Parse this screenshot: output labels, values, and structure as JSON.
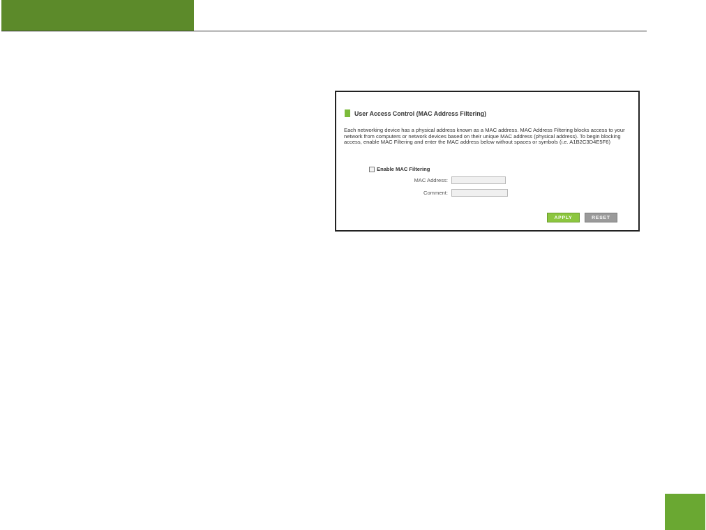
{
  "panel": {
    "title": "User Access Control (MAC Address Filtering)",
    "description": "Each networking device has a physical address known as a MAC address. MAC Address Filtering blocks access to your network from computers or network devices based on their unique MAC address (physical address). To begin blocking access, enable MAC Filtering and enter the MAC address below without spaces or symbols (i.e. A1B2C3D4E5F6)",
    "enable_label": "Enable MAC Filtering",
    "enable_checked": false,
    "mac_label": "MAC Address:",
    "mac_value": "",
    "comment_label": "Comment:",
    "comment_value": "",
    "apply_label": "APPLY",
    "reset_label": "RESET"
  },
  "colors": {
    "header_green": "#5c8a2a",
    "accent_green": "#7cbb3a",
    "apply_green": "#8cc63f",
    "reset_gray": "#9a9a9a",
    "page_box_green": "#6aa832"
  }
}
